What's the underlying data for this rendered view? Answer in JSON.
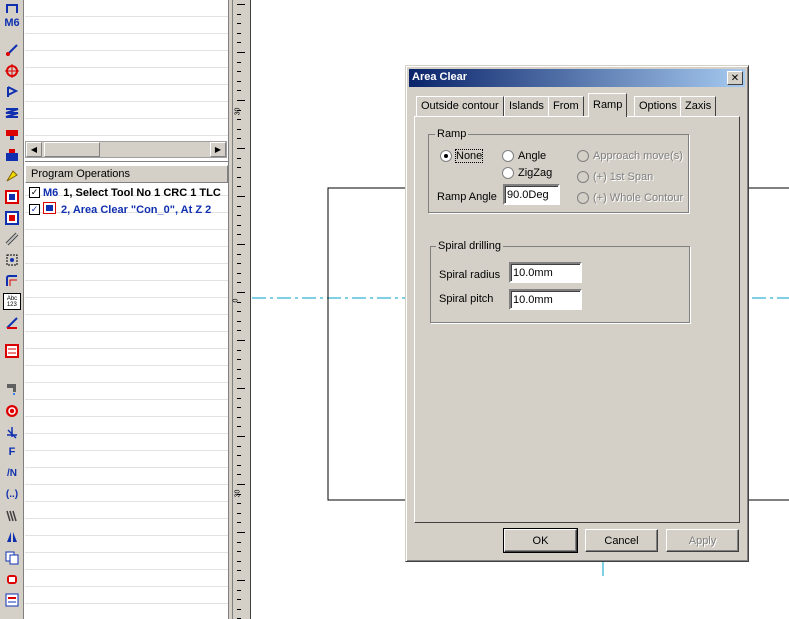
{
  "toolbar": {
    "m6_label": "M6",
    "f_label": "F",
    "n_label": "/N",
    "dots_label": "(..)",
    "abc_label": "Abc\n123"
  },
  "program_operations": {
    "header": "Program Operations",
    "rows": [
      {
        "checked": true,
        "code": "M6",
        "text": "1, Select Tool No 1 CRC 1 TLC"
      },
      {
        "checked": true,
        "code": "",
        "text": "2, Area Clear \"Con_0\", At Z 2"
      }
    ]
  },
  "ruler": {
    "labels": [
      "30",
      "0",
      "30"
    ]
  },
  "dialog": {
    "title": "Area Clear",
    "close_symbol": "✕",
    "tabs": [
      "Outside contour",
      "Islands",
      "From",
      "Ramp",
      "Options",
      "Zaxis"
    ],
    "active_tab": "Ramp",
    "ramp_group": {
      "title": "Ramp",
      "options": [
        {
          "label": "None",
          "checked": true,
          "enabled": true
        },
        {
          "label": "Angle",
          "checked": false,
          "enabled": true
        },
        {
          "label": "ZigZag",
          "checked": false,
          "enabled": true
        },
        {
          "label": "Approach move(s)",
          "checked": false,
          "enabled": false
        },
        {
          "label": "(+) 1st Span",
          "checked": false,
          "enabled": false
        },
        {
          "label": "(+) Whole Contour",
          "checked": false,
          "enabled": false
        }
      ],
      "ramp_angle_label": "Ramp Angle",
      "ramp_angle_value": "90.0Deg"
    },
    "spiral_group": {
      "title": "Spiral drilling",
      "radius_label": "Spiral radius",
      "radius_value": "10.0mm",
      "pitch_label": "Spiral pitch",
      "pitch_value": "10.0mm"
    },
    "buttons": {
      "ok": "OK",
      "cancel": "Cancel",
      "apply": "Apply",
      "apply_enabled": false
    }
  },
  "colors": {
    "titlebar_start": "#0a246a",
    "titlebar_end": "#a6caf0",
    "centerline": "#00a0c8",
    "face": "#d4d0c8"
  }
}
